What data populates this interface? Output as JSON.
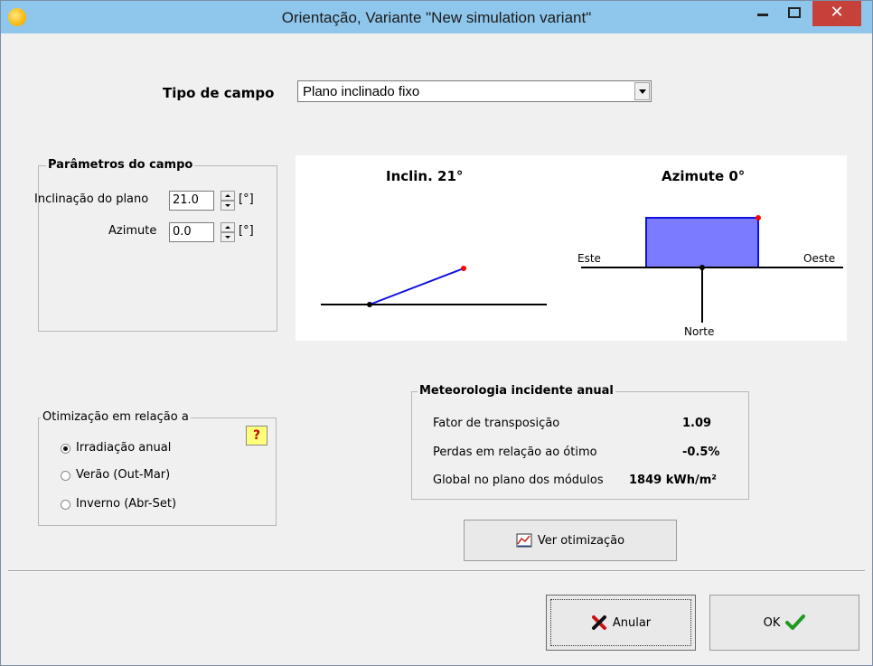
{
  "window": {
    "title": "Orientação, Variante \"New simulation variant\""
  },
  "field_type": {
    "label": "Tipo de campo",
    "value": "Plano inclinado fixo"
  },
  "parameters": {
    "title": "Parâmetros do campo",
    "tilt_label": "Inclinação do plano",
    "tilt_value": "21.0",
    "tilt_unit": "[°]",
    "azimuth_label": "Azimute",
    "azimuth_value": "0.0",
    "azimuth_unit": "[°]"
  },
  "diagram": {
    "tilt_title": "Inclin. 21°",
    "azimuth_title": "Azimute 0°",
    "east": "Este",
    "west": "Oeste",
    "north": "Norte",
    "panel_color": "#7b7bff",
    "line_color": "#1010e0",
    "marker_color": "#ff0000"
  },
  "optimization": {
    "title": "Otimização em relação a",
    "options": [
      {
        "label": "Irradiação anual",
        "checked": true
      },
      {
        "label": "Verão (Out-Mar)",
        "checked": false
      },
      {
        "label": "Inverno (Abr-Set)",
        "checked": false
      }
    ],
    "help_label": "?"
  },
  "meteo": {
    "title": "Meteorologia incidente anual",
    "rows": [
      {
        "label": "Fator de transposição",
        "value": "1.09"
      },
      {
        "label": "Perdas em relação ao ótimo",
        "value": "-0.5%"
      },
      {
        "label": "Global no plano dos módulos",
        "value": "1849 kWh/m²"
      }
    ]
  },
  "buttons": {
    "view_optimization": "Ver otimização",
    "cancel": "Anular",
    "ok": "OK"
  }
}
